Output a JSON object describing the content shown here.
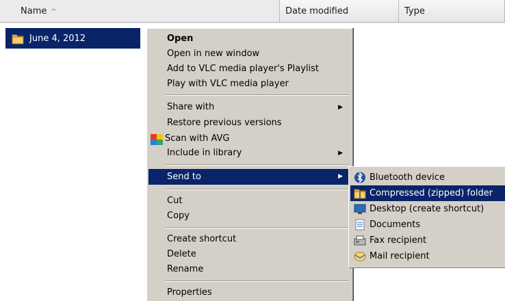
{
  "columns": {
    "name": "Name",
    "date_modified": "Date modified",
    "type": "Type"
  },
  "file": {
    "name": "June 4, 2012"
  },
  "context_menu": {
    "open": "Open",
    "open_new_window": "Open in new window",
    "add_vlc_playlist": "Add to VLC media player's Playlist",
    "play_vlc": "Play with VLC media player",
    "share_with": "Share with",
    "restore_previous": "Restore previous versions",
    "scan_avg": "Scan with AVG",
    "include_library": "Include in library",
    "send_to": "Send to",
    "cut": "Cut",
    "copy": "Copy",
    "create_shortcut": "Create shortcut",
    "delete": "Delete",
    "rename": "Rename",
    "properties": "Properties"
  },
  "send_to_menu": {
    "bluetooth": "Bluetooth device",
    "compressed": "Compressed (zipped) folder",
    "desktop": "Desktop (create shortcut)",
    "documents": "Documents",
    "fax": "Fax recipient",
    "mail": "Mail recipient"
  },
  "colors": {
    "selection": "#0a246a",
    "menu_bg": "#d4d0c8"
  }
}
